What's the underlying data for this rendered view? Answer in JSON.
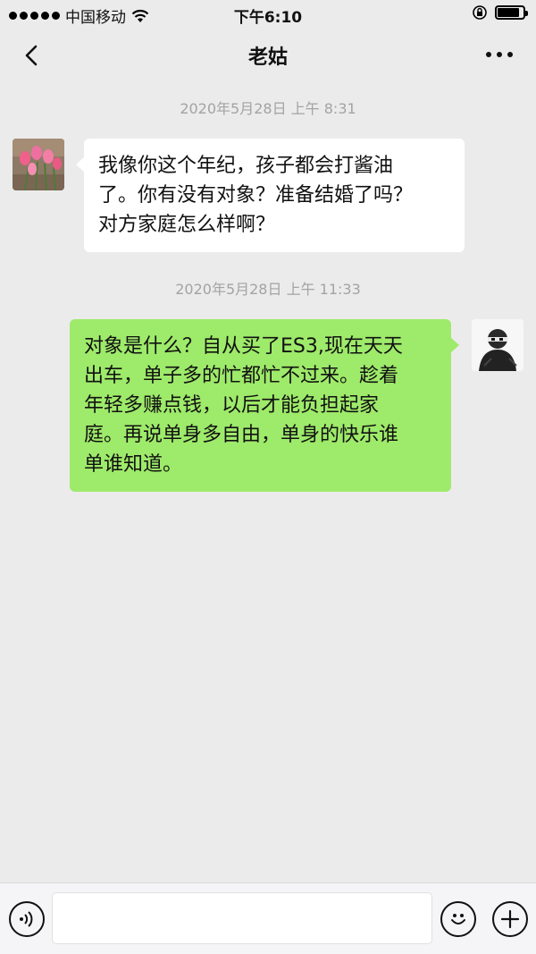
{
  "status_bar": {
    "carrier": "中国移动",
    "time": "下午6:10",
    "battery_level": 0.85
  },
  "nav": {
    "title": "老姑",
    "back_icon": "chevron-left-icon",
    "more_icon": "more-dots-icon"
  },
  "messages": [
    {
      "timestamp": "2020年5月28日 上午 8:31",
      "sender": "contact",
      "lines": [
        "我像你这个年纪，孩子都会打酱油",
        "了。你有没有对象？准备结婚了吗？",
        "对方家庭怎么样啊？"
      ]
    },
    {
      "timestamp": "2020年5月28日 上午 11:33",
      "sender": "me",
      "lines": [
        "对象是什么？自从买了ES3,现在天天",
        "出车，单子多的忙都忙不过来。趁着",
        "年轻多赚点钱，以后才能负担起家",
        "庭。再说单身多自由，单身的快乐谁",
        "单谁知道。"
      ]
    }
  ],
  "input_bar": {
    "voice_icon": "voice-icon",
    "emoji_icon": "emoji-icon",
    "plus_icon": "plus-icon",
    "text_value": ""
  },
  "colors": {
    "background": "#ebebeb",
    "incoming_bubble": "#ffffff",
    "outgoing_bubble": "#9eea6a",
    "timestamp": "#a3a3a3"
  }
}
